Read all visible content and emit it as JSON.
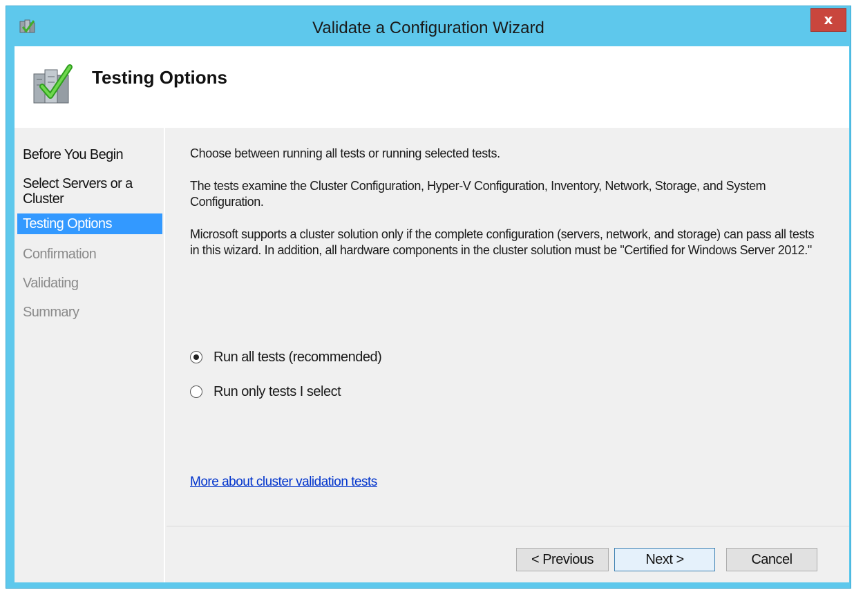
{
  "window": {
    "title": "Validate a Configuration Wizard",
    "close_label": "x"
  },
  "header": {
    "title": "Testing Options"
  },
  "steps": [
    {
      "label": "Before You Begin",
      "state": "normal"
    },
    {
      "label": "Select Servers or a Cluster",
      "state": "normal"
    },
    {
      "label": "Testing Options",
      "state": "active"
    },
    {
      "label": "Confirmation",
      "state": "disabled"
    },
    {
      "label": "Validating",
      "state": "disabled"
    },
    {
      "label": "Summary",
      "state": "disabled"
    }
  ],
  "content": {
    "intro": "Choose between running all tests or running selected tests.",
    "tests_description": "The tests examine the Cluster Configuration, Hyper-V Configuration, Inventory, Network, Storage, and System Configuration.",
    "support_note": "Microsoft supports a cluster solution only if the complete configuration (servers, network, and storage) can pass all tests in this wizard. In addition, all hardware components in the cluster solution must be \"Certified for Windows Server 2012.\"",
    "options": [
      {
        "label": "Run all tests (recommended)",
        "selected": true
      },
      {
        "label": "Run only tests I select",
        "selected": false
      }
    ],
    "link": "More about cluster validation tests"
  },
  "buttons": {
    "previous": "< Previous",
    "next": "Next >",
    "cancel": "Cancel"
  },
  "colors": {
    "titlebar": "#5ec8ec",
    "close": "#c9463d",
    "selected_step": "#3399ff",
    "link": "#0033cc"
  }
}
